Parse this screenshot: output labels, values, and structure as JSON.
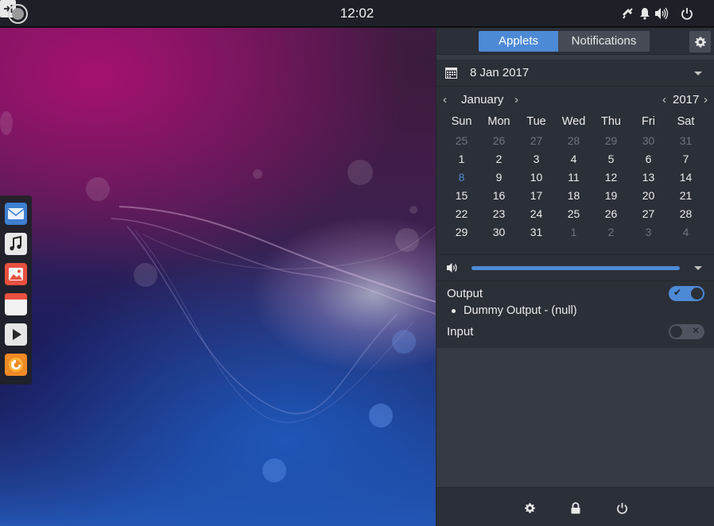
{
  "top_panel": {
    "clock": "12:02",
    "menu_icon": "menu-icon",
    "tray_icons": [
      "network-icon",
      "notification-bell-icon",
      "volume-icon",
      "power-icon",
      "sidebar-toggle-icon"
    ]
  },
  "dock": {
    "items": [
      {
        "name": "mail-app",
        "icon": "mail-icon"
      },
      {
        "name": "music-app",
        "icon": "music-note-icon"
      },
      {
        "name": "photos-app",
        "icon": "photos-icon"
      },
      {
        "name": "calendar-app",
        "icon": "calendar-app-icon"
      },
      {
        "name": "video-app",
        "icon": "play-icon"
      },
      {
        "name": "firefox-app",
        "icon": "firefox-icon"
      }
    ]
  },
  "raven": {
    "tabs": {
      "applets": "Applets",
      "notifications": "Notifications"
    },
    "active_tab": "Applets",
    "calendar": {
      "date": "8 Jan 2017",
      "month": "January",
      "year": "2017",
      "prev_arrow": "‹",
      "next_arrow": "›",
      "weekdays": [
        "Sun",
        "Mon",
        "Tue",
        "Wed",
        "Thu",
        "Fri",
        "Sat"
      ],
      "weeks": [
        [
          {
            "d": "25",
            "dim": true
          },
          {
            "d": "26",
            "dim": true
          },
          {
            "d": "27",
            "dim": true
          },
          {
            "d": "28",
            "dim": true
          },
          {
            "d": "29",
            "dim": true
          },
          {
            "d": "30",
            "dim": true
          },
          {
            "d": "31",
            "dim": true
          }
        ],
        [
          {
            "d": "1"
          },
          {
            "d": "2"
          },
          {
            "d": "3"
          },
          {
            "d": "4"
          },
          {
            "d": "5"
          },
          {
            "d": "6"
          },
          {
            "d": "7"
          }
        ],
        [
          {
            "d": "8",
            "today": true
          },
          {
            "d": "9"
          },
          {
            "d": "10"
          },
          {
            "d": "11"
          },
          {
            "d": "12"
          },
          {
            "d": "13"
          },
          {
            "d": "14"
          }
        ],
        [
          {
            "d": "15"
          },
          {
            "d": "16"
          },
          {
            "d": "17"
          },
          {
            "d": "18"
          },
          {
            "d": "19"
          },
          {
            "d": "20"
          },
          {
            "d": "21"
          }
        ],
        [
          {
            "d": "22"
          },
          {
            "d": "23"
          },
          {
            "d": "24"
          },
          {
            "d": "25"
          },
          {
            "d": "26"
          },
          {
            "d": "27"
          },
          {
            "d": "28"
          }
        ],
        [
          {
            "d": "29"
          },
          {
            "d": "30"
          },
          {
            "d": "31"
          },
          {
            "d": "1",
            "dim": true
          },
          {
            "d": "2",
            "dim": true
          },
          {
            "d": "3",
            "dim": true
          },
          {
            "d": "4",
            "dim": true
          }
        ]
      ]
    },
    "sound": {
      "volume_fraction": 1.0,
      "output_label": "Output",
      "output_enabled": true,
      "output_toggle_mark": "✔",
      "output_device": "Dummy Output - (null)",
      "input_label": "Input",
      "input_enabled": false,
      "input_toggle_mark": "✕"
    },
    "footer": [
      "settings-icon",
      "lock-icon",
      "power-icon"
    ]
  },
  "colors": {
    "accent": "#4d8ad6",
    "panel_bg": "#1d2026",
    "applet_bg": "#2b2f37",
    "sidebar_bg": "#353a44"
  }
}
